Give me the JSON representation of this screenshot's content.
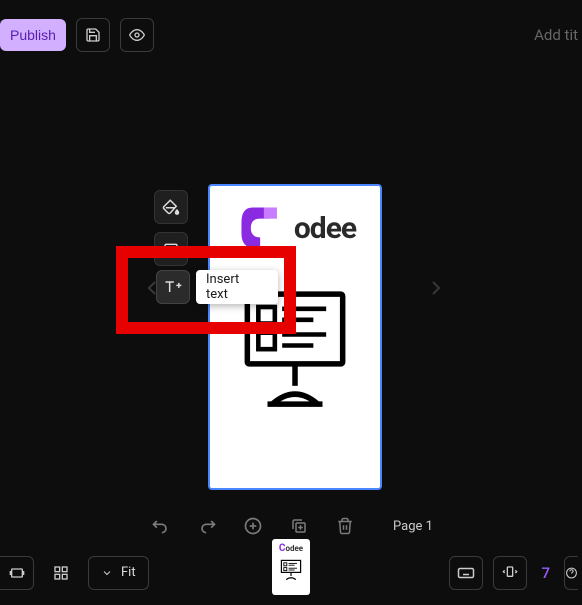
{
  "topbar": {
    "publish_label": "Publish",
    "title_placeholder": "Add tit"
  },
  "tools": {
    "insert_text_tooltip": "Insert text"
  },
  "page": {
    "logo_text": "odee"
  },
  "controls": {
    "page_indicator": "Page 1"
  },
  "bottom": {
    "zoom_label": "Fit",
    "page_count": "7"
  }
}
